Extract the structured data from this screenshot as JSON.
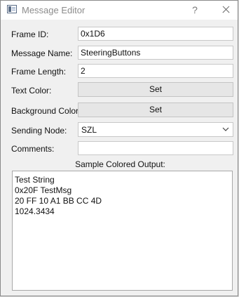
{
  "window": {
    "title": "Message Editor",
    "help_symbol": "?"
  },
  "form": {
    "frame_id": {
      "label": "Frame ID:",
      "value": "0x1D6"
    },
    "message_name": {
      "label": "Message Name:",
      "value": "SteeringButtons"
    },
    "frame_length": {
      "label": "Frame Length:",
      "value": "2"
    },
    "text_color": {
      "label": "Text Color:",
      "button": "Set"
    },
    "background_color": {
      "label": "Background Color:",
      "button": "Set"
    },
    "sending_node": {
      "label": "Sending Node:",
      "value": "SZL"
    },
    "comments": {
      "label": "Comments:",
      "value": ""
    }
  },
  "output": {
    "caption": "Sample Colored Output:",
    "lines": [
      "Test String",
      "0x20F TestMsg",
      "20 FF 10 A1 BB CC 4D",
      "1024.3434"
    ]
  }
}
